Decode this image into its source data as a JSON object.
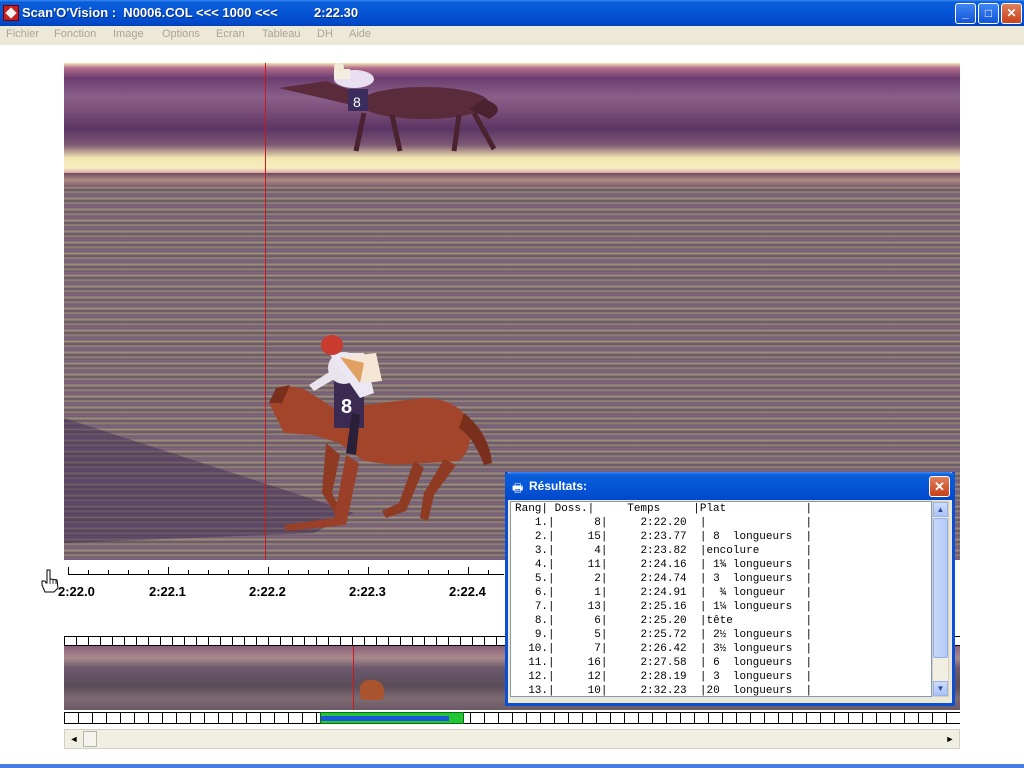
{
  "window": {
    "title": "Scan'O'Vision :  N0006.COL <<< 1000 <<<",
    "time": "2:22.30",
    "controls": {
      "minimize": "_",
      "maximize": "□",
      "close": "✕"
    }
  },
  "menu": [
    "Fichier",
    "Fonction",
    "Image",
    "Options",
    "Ecran",
    "Tableau",
    "DH",
    "Aide"
  ],
  "ruler": {
    "labels": [
      "2:22.0",
      "2:22.1",
      "2:22.2",
      "2:22.3",
      "2:22.4"
    ],
    "hand_icon": "pointing-hand-icon"
  },
  "results": {
    "title": "Résultats:",
    "icon": "printer-icon",
    "close": "✕",
    "columns": [
      "Rang",
      "Doss.",
      "Temps",
      "Plat"
    ],
    "rows": [
      {
        "rang": "1.",
        "doss": "8",
        "temps": "2:22.20",
        "plat": ""
      },
      {
        "rang": "2.",
        "doss": "15",
        "temps": "2:23.77",
        "plat": " 8  longueurs"
      },
      {
        "rang": "3.",
        "doss": "4",
        "temps": "2:23.82",
        "plat": "encolure"
      },
      {
        "rang": "4.",
        "doss": "11",
        "temps": "2:24.16",
        "plat": " 1¾ longueurs"
      },
      {
        "rang": "5.",
        "doss": "2",
        "temps": "2:24.74",
        "plat": " 3  longueurs"
      },
      {
        "rang": "6.",
        "doss": "1",
        "temps": "2:24.91",
        "plat": "  ¾ longueur"
      },
      {
        "rang": "7.",
        "doss": "13",
        "temps": "2:25.16",
        "plat": " 1¼ longueurs"
      },
      {
        "rang": "8.",
        "doss": "6",
        "temps": "2:25.20",
        "plat": "tête"
      },
      {
        "rang": "9.",
        "doss": "5",
        "temps": "2:25.72",
        "plat": " 2½ longueurs"
      },
      {
        "rang": "10.",
        "doss": "7",
        "temps": "2:26.42",
        "plat": " 3½ longueurs"
      },
      {
        "rang": "11.",
        "doss": "16",
        "temps": "2:27.58",
        "plat": " 6  longueurs"
      },
      {
        "rang": "12.",
        "doss": "12",
        "temps": "2:28.19",
        "plat": " 3  longueurs"
      },
      {
        "rang": "13.",
        "doss": "10",
        "temps": "2:32.23",
        "plat": "20  longueurs"
      }
    ]
  },
  "scrollbar": {
    "left": "◄",
    "right": "►",
    "up": "▲",
    "down": "▼"
  }
}
